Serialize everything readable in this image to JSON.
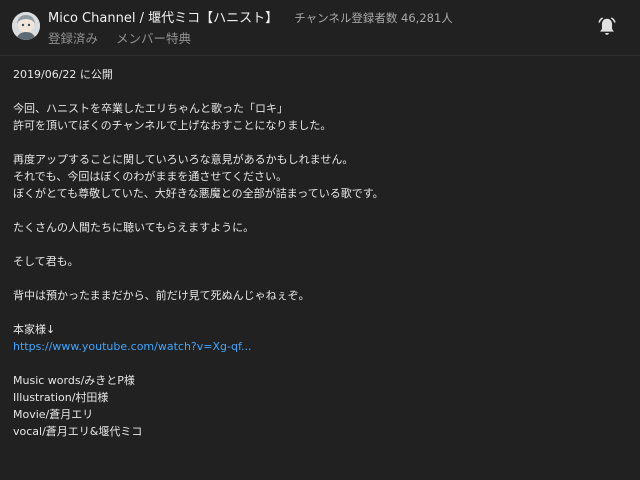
{
  "header": {
    "channel_name": "Mico Channel / 堰代ミコ【ハニスト】",
    "subscriber_text": "チャンネル登録者数 46,281人",
    "subscribed_label": "登録済み",
    "member_perks_label": "メンバー特典",
    "avatar_icon": "avatar-image",
    "bell_icon": "bell-icon"
  },
  "description": {
    "published": "2019/06/22 に公開",
    "para1_line1": "今回、ハニストを卒業したエリちゃんと歌った「ロキ」",
    "para1_line2": "許可を頂いてぼくのチャンネルで上げなおすことになりました。",
    "para2_line1": "再度アップすることに関していろいろな意見があるかもしれません。",
    "para2_line2": "それでも、今回はぼくのわがままを通させてください。",
    "para2_line3": "ぼくがとても尊敬していた、大好きな悪魔との全部が詰まっている歌です。",
    "para3": "たくさんの人間たちに聴いてもらえますように。",
    "para4": "そして君も。",
    "para5": "背中は預かったままだから、前だけ見て死ぬんじゃねぇぞ。",
    "original_label": "本家様↓",
    "original_link": "https://www.youtube.com/watch?v=Xg-qf...",
    "credit_music": "Music words/みきとP様",
    "credit_illustration": "Illustration/村田様",
    "credit_movie": "Movie/蒼月エリ",
    "credit_vocal": "vocal/蒼月エリ&堰代ミコ"
  },
  "colors": {
    "background": "#212121",
    "link": "#3ea6ff",
    "muted": "#909090"
  }
}
